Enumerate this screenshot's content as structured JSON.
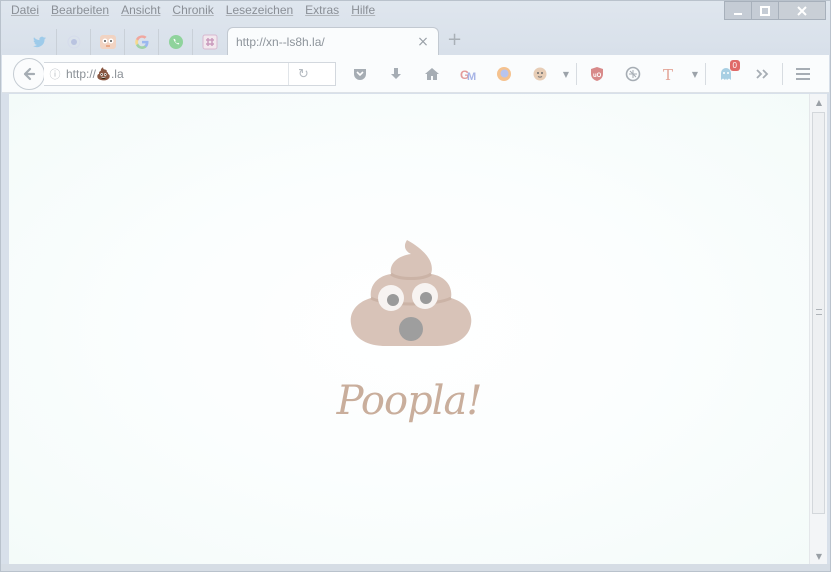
{
  "menu": [
    "Datei",
    "Bearbeiten",
    "Ansicht",
    "Chronik",
    "Lesezeichen",
    "Extras",
    "Hilfe"
  ],
  "window_controls": {
    "minimize": "minimize",
    "maximize": "maximize",
    "close": "close"
  },
  "pinned_tabs": [
    {
      "name": "twitter",
      "color": "#9ecbea",
      "glyph": "t"
    },
    {
      "name": "extension",
      "color": "#b9c3e0",
      "glyph": "•"
    },
    {
      "name": "duckduckgo",
      "color": "#e7a17e",
      "glyph": "D"
    },
    {
      "name": "google",
      "color": "#ffffff",
      "glyph": "G"
    },
    {
      "name": "whatsapp",
      "color": "#8fd39c",
      "glyph": "W"
    },
    {
      "name": "slack",
      "color": "#d8b8d0",
      "glyph": "S"
    }
  ],
  "active_tab": {
    "title": "http://xn--ls8h.la/",
    "close": "×"
  },
  "new_tab": "+",
  "urlbar": {
    "value": "http://💩.la",
    "info": "ⓘ",
    "reload": "↻"
  },
  "toolbar_badge": "0",
  "page": {
    "headline": "Poopla!"
  },
  "colors": {
    "accent": "#c9ae9c",
    "poop": "#d8c3b8",
    "eye": "#f7f3f1",
    "pupil": "#9a9a9a"
  }
}
